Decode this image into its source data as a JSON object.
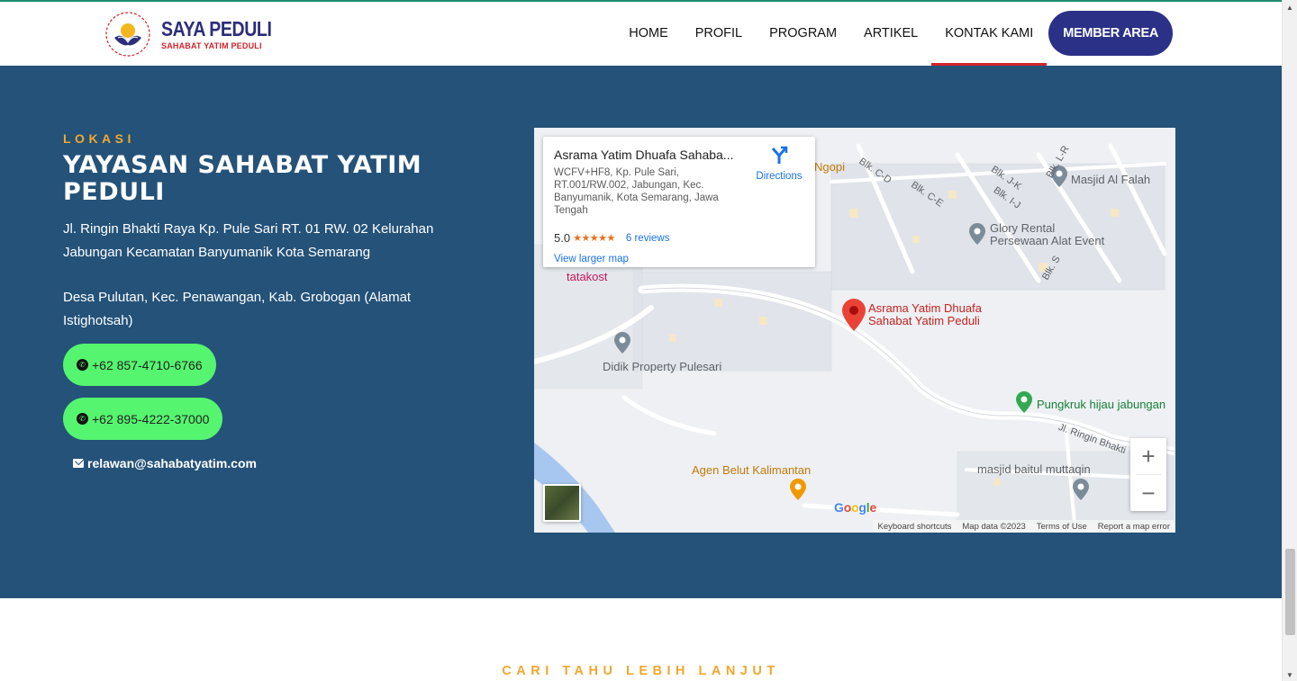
{
  "header": {
    "logo_title": "SAYA PEDULI",
    "logo_subtitle": "SAHABAT YATIM PEDULI",
    "nav": [
      "HOME",
      "PROFIL",
      "PROGRAM",
      "ARTIKEL",
      "KONTAK KAMI"
    ],
    "active_nav": "KONTAK KAMI",
    "member_button": "MEMBER AREA"
  },
  "location": {
    "eyebrow": "LOKASI",
    "title": "YAYASAN SAHABAT YATIM PEDULI",
    "address": "Jl. Ringin Bhakti Raya Kp. Pule Sari RT. 01 RW. 02 Kelurahan Jabungan Kecamatan Banyumanik Kota Semarang",
    "address2": "Desa Pulutan, Kec. Penawangan, Kab. Grobogan (Alamat Istighotsah)",
    "phone1": "+62 857-4710-6766",
    "phone2": "+62 895-4222-37000",
    "email": "relawan@sahabatyatim.com"
  },
  "map": {
    "place_name": "Asrama Yatim Dhuafa Sahaba...",
    "place_address": "WCFV+HF8, Kp. Pule Sari, RT.001/RW.002, Jabungan, Kec. Banyumanik, Kota Semarang, Jawa Tengah",
    "rating": "5.0",
    "stars": "★★★★★",
    "reviews": "6 reviews",
    "larger_map": "View larger map",
    "directions": "Directions",
    "pin_label_1": "Asrama Yatim Dhuafa",
    "pin_label_2": "Sahabat Yatim Peduli",
    "labels": {
      "masjid_al_falah": "Masjid Al Falah",
      "glory_1": "Glory Rental",
      "glory_2": "Persewaan Alat Event",
      "didik": "Didik Property Pulesari",
      "pungkruk": "Pungkruk hijau jabungan",
      "belut": "Agen Belut Kalimantan",
      "baitul": "masjid baitul muttaqin",
      "ngopi": "Ngopi",
      "tatakost": "tatakost",
      "ringin": "Jl. Ringin Bhakti",
      "blk_cd": "Blk. C-D",
      "blk_ce": "Blk. C-E",
      "blk_jk": "Blk. J-K",
      "blk_ij": "Blk. I-J",
      "blk_lr": "Blk. L-R",
      "blk_s": "Blk. S"
    },
    "zoom_in": "+",
    "zoom_out": "−",
    "google": "Google",
    "footer": {
      "shortcuts": "Keyboard shortcuts",
      "data": "Map data ©2023",
      "terms": "Terms of Use",
      "report": "Report a map error"
    }
  },
  "cari": "CARI TAHU LEBIH LANJUT",
  "colors": {
    "section_bg": "#245279",
    "accent": "#f3a72e",
    "whatsapp": "#55f56f",
    "member": "#2b3187",
    "active_underline": "#d2232a"
  }
}
